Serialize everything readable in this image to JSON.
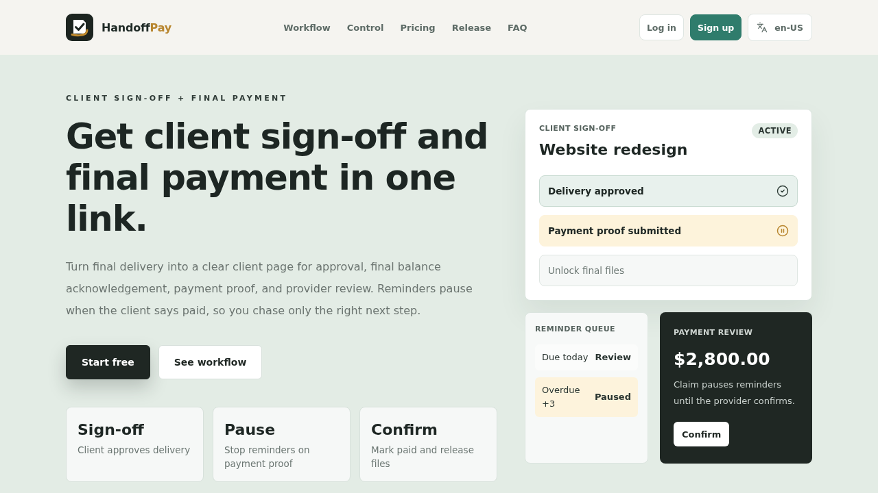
{
  "header": {
    "brand": {
      "name": "Handoff",
      "accent": "Pay"
    },
    "nav": [
      {
        "label": "Workflow"
      },
      {
        "label": "Control"
      },
      {
        "label": "Pricing"
      },
      {
        "label": "Release"
      },
      {
        "label": "FAQ"
      }
    ],
    "actions": [
      {
        "label": "Log in",
        "kind": "outline"
      },
      {
        "label": "Sign up",
        "kind": "primary"
      }
    ],
    "language": {
      "label": "en-US"
    }
  },
  "hero": {
    "eyebrow": "CLIENT SIGN-OFF + FINAL PAYMENT",
    "title": "Get client sign-off and final payment in one link.",
    "description": "Turn final delivery into a clear client page for approval, final balance acknowledgement, payment proof, and provider review. Reminders pause when the client says paid, so you chase only the right next step.",
    "buttons": [
      {
        "label": "Start free",
        "kind": "primary"
      },
      {
        "label": "See workflow",
        "kind": "secondary"
      }
    ],
    "features": [
      {
        "title": "Sign-off",
        "text": "Client approves delivery"
      },
      {
        "title": "Pause",
        "text": "Stop reminders on payment proof"
      },
      {
        "title": "Confirm",
        "text": "Mark paid and release files"
      }
    ]
  },
  "signoff_card": {
    "label": "CLIENT SIGN-OFF",
    "badge": "ACTIVE",
    "title": "Website redesign",
    "steps": [
      {
        "label": "Delivery approved",
        "kind": "done"
      },
      {
        "label": "Payment proof submitted",
        "kind": "waiting"
      },
      {
        "label": "Unlock final files",
        "kind": "locked"
      }
    ]
  },
  "reminder_queue": {
    "title": "REMINDER QUEUE",
    "rows": [
      {
        "label": "Due today",
        "status": "Review",
        "highlighted": false
      },
      {
        "label": "Overdue +3",
        "status": "Paused",
        "highlighted": true
      }
    ]
  },
  "payment_review": {
    "title": "PAYMENT REVIEW",
    "amount": "$2,800.00",
    "text": "Claim pauses reminders until the provider confirms.",
    "button": "Confirm"
  }
}
